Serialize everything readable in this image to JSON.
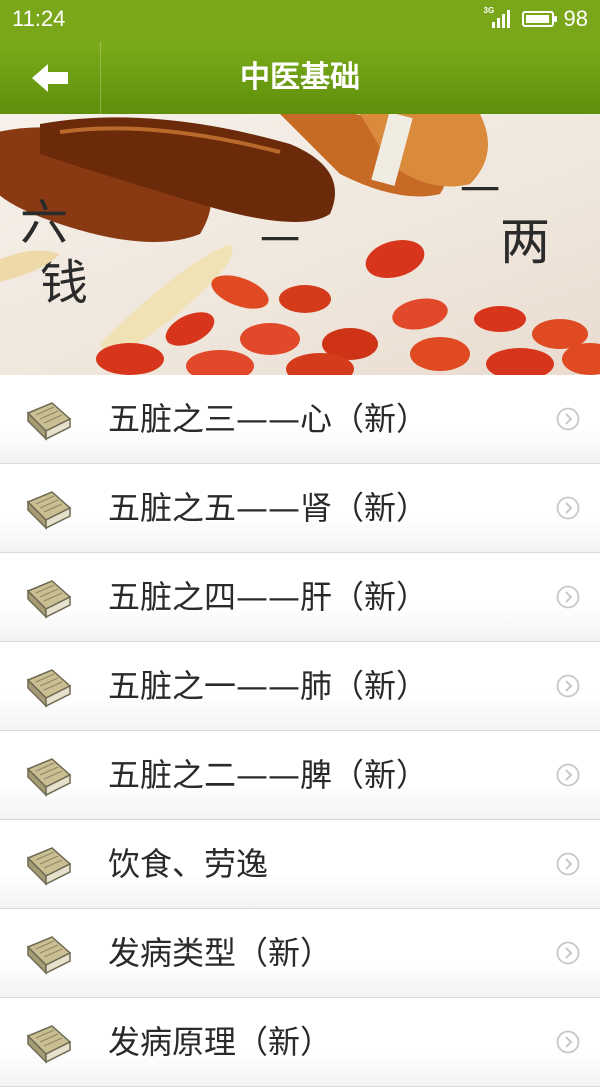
{
  "status_bar": {
    "time": "11:24",
    "network": "3G",
    "battery": "98",
    "battery_level": 0.98
  },
  "header": {
    "title": "中医基础",
    "back_icon": "arrow-left-icon",
    "color": "#6e9f12"
  },
  "banner": {
    "calligraphy": [
      "六",
      "钱",
      "一",
      "两",
      "一"
    ]
  },
  "list": {
    "items": [
      {
        "label": "五脏之三——心（新）"
      },
      {
        "label": "五脏之五——肾（新）"
      },
      {
        "label": "五脏之四——肝（新）"
      },
      {
        "label": "五脏之一——肺（新）"
      },
      {
        "label": "五脏之二——脾（新）"
      },
      {
        "label": "饮食、劳逸"
      },
      {
        "label": "发病类型（新）"
      },
      {
        "label": "发病原理（新）"
      }
    ],
    "item_icon": "book-icon",
    "chevron_icon": "chevron-right-circle-icon"
  }
}
